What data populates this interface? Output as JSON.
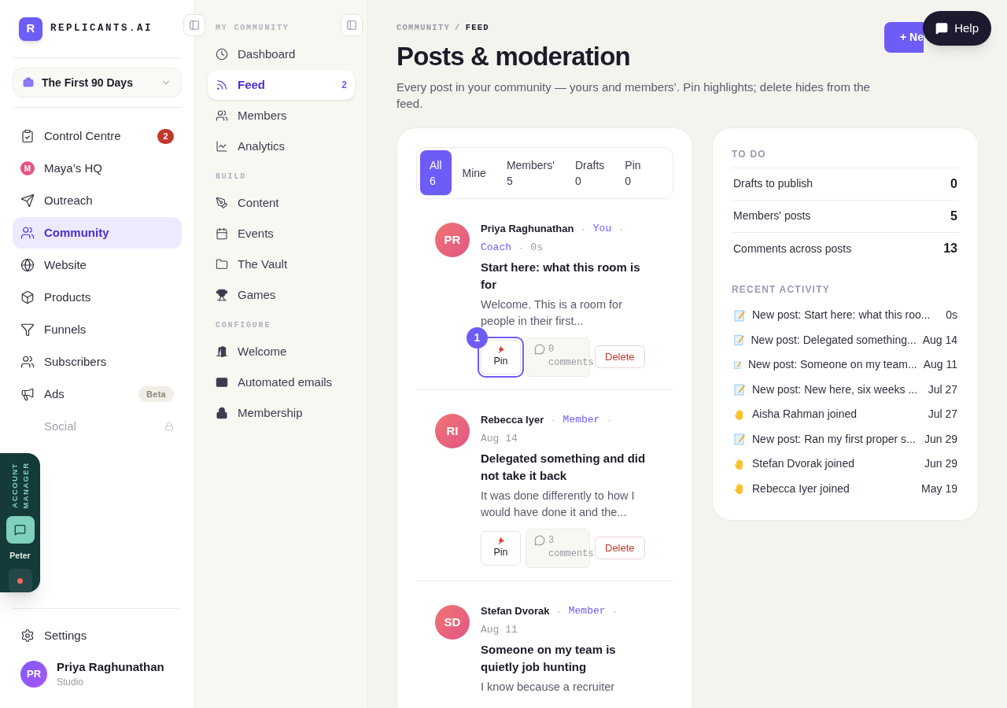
{
  "brand": {
    "initial": "R",
    "name": "REPLICANTS.AI"
  },
  "workspace": {
    "name": "The First 90 Days"
  },
  "nav": [
    {
      "label": "Control Centre",
      "selected": false,
      "badge": "2"
    },
    {
      "label": "Maya’s HQ",
      "selected": false,
      "avatar": "M"
    },
    {
      "label": "Outreach",
      "selected": false
    },
    {
      "label": "Community",
      "selected": true
    },
    {
      "label": "Website",
      "selected": false
    },
    {
      "label": "Products",
      "selected": false
    },
    {
      "label": "Funnels",
      "selected": false
    },
    {
      "label": "Subscribers",
      "selected": false
    },
    {
      "label": "Ads",
      "selected": false,
      "tag": "Beta"
    },
    {
      "label": "Social",
      "selected": false,
      "disabled": true
    }
  ],
  "settings": "Settings",
  "user": {
    "initials": "PR",
    "name": "Priya Raghunathan",
    "plan": "Studio"
  },
  "account_manager": {
    "label": "ACCOUNT MANAGER",
    "name": "Peter"
  },
  "subnav": [
    {
      "heading": "MY COMMUNITY",
      "items": [
        {
          "label": "Dashboard",
          "selected": false
        },
        {
          "label": "Feed",
          "selected": true,
          "count": "2"
        },
        {
          "label": "Members",
          "selected": false
        },
        {
          "label": "Analytics",
          "selected": false
        }
      ]
    },
    {
      "heading": "BUILD",
      "items": [
        {
          "label": "Content",
          "selected": false
        },
        {
          "label": "Events",
          "selected": false
        },
        {
          "label": "The Vault",
          "selected": false
        },
        {
          "label": "Games",
          "selected": false
        }
      ]
    },
    {
      "heading": "CONFIGURE",
      "items": [
        {
          "label": "Welcome",
          "selected": false
        },
        {
          "label": "Automated emails",
          "selected": false
        },
        {
          "label": "Membership",
          "selected": false
        }
      ]
    }
  ],
  "breadcrumb": [
    "COMMUNITY",
    "/",
    "FEED"
  ],
  "title": "Posts & moderation",
  "subtitle": "Every post in your community — yours and members’. Pin highlights; delete hides from the feed.",
  "new_button": "+ Ne",
  "help_button": "Help",
  "tabs": [
    {
      "label": "All",
      "count": "6",
      "selected": true
    },
    {
      "label": "Mine",
      "selected": false
    },
    {
      "label": "Members'",
      "count": "5",
      "selected": false
    },
    {
      "label": "Drafts",
      "count": "0",
      "selected": false
    },
    {
      "label": "Pin",
      "count": "0",
      "selected": false
    }
  ],
  "posts": [
    {
      "initials": "PR",
      "meta": [
        {
          "kind": "author",
          "text": "Priya Raghunathan"
        },
        {
          "kind": "dot",
          "text": "·"
        },
        {
          "kind": "role",
          "text": "You"
        },
        {
          "kind": "dot",
          "text": "·"
        },
        {
          "kind": "role",
          "text": "Coach"
        },
        {
          "kind": "dot",
          "text": "·"
        },
        {
          "kind": "time",
          "text": "0s"
        }
      ],
      "title": "Start here: what this room is for",
      "excerpt": "Welcome. This is a room for people in their first...",
      "pin": "Pin",
      "coach_mark": "1",
      "comments": "0 comments",
      "delete": "Delete"
    },
    {
      "initials": "RI",
      "meta": [
        {
          "kind": "author",
          "text": "Rebecca Iyer"
        },
        {
          "kind": "dot",
          "text": "·"
        },
        {
          "kind": "role",
          "text": "Member"
        },
        {
          "kind": "dot",
          "text": "·"
        },
        {
          "kind": "time",
          "text": "Aug 14"
        }
      ],
      "title": "Delegated something and did not take it back",
      "excerpt": "It was done differently to how I would have done it and the...",
      "pin": "Pin",
      "comments": "3 comments",
      "delete": "Delete"
    },
    {
      "initials": "SD",
      "meta": [
        {
          "kind": "author",
          "text": "Stefan Dvorak"
        },
        {
          "kind": "dot",
          "text": "·"
        },
        {
          "kind": "role",
          "text": "Member"
        },
        {
          "kind": "dot",
          "text": "·"
        },
        {
          "kind": "time",
          "text": "Aug 11"
        }
      ],
      "title": "Someone on my team is quietly job hunting",
      "excerpt": "I know because a recruiter"
    }
  ],
  "todo": {
    "heading": "TO DO",
    "rows": [
      {
        "label": "Drafts to publish",
        "value": "0"
      },
      {
        "label": "Members' posts",
        "value": "5"
      },
      {
        "label": "Comments across posts",
        "value": "13"
      }
    ]
  },
  "activity": {
    "heading": "RECENT ACTIVITY",
    "items": [
      {
        "kind": "post",
        "text": "New post: Start here: what this roo...",
        "time": "0s"
      },
      {
        "kind": "post",
        "text": "New post: Delegated something...",
        "time": "Aug 14"
      },
      {
        "kind": "post",
        "text": "New post: Someone on my team...",
        "time": "Aug 11"
      },
      {
        "kind": "post",
        "text": "New post: New here, six weeks ...",
        "time": "Jul 27"
      },
      {
        "kind": "join",
        "text": "Aisha Rahman joined",
        "time": "Jul 27"
      },
      {
        "kind": "post",
        "text": "New post: Ran my first proper s...",
        "time": "Jun 29"
      },
      {
        "kind": "join",
        "text": "Stefan Dvorak joined",
        "time": "Jun 29"
      },
      {
        "kind": "join",
        "text": "Rebecca Iyer joined",
        "time": "May 19"
      }
    ]
  }
}
